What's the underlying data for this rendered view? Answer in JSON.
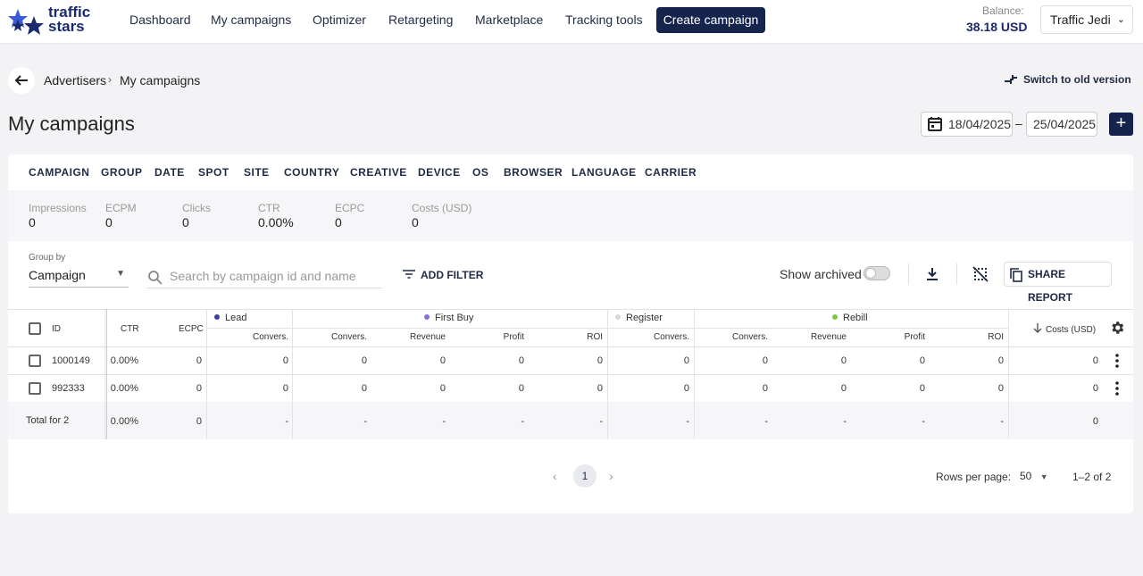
{
  "brand": {
    "name_line1": "traffic",
    "name_line2": "stars"
  },
  "nav": {
    "items": [
      "Dashboard",
      "My campaigns",
      "Optimizer",
      "Retargeting",
      "Marketplace",
      "Tracking tools"
    ],
    "create_campaign": "Create campaign",
    "balance_label": "Balance:",
    "balance_value": "38.18 USD",
    "account_name": "Traffic Jedi"
  },
  "breadcrumb": {
    "items": [
      "Advertisers",
      "My campaigns"
    ],
    "switch_old": "Switch to old version"
  },
  "page": {
    "title": "My campaigns"
  },
  "date_range": {
    "from": "18/04/2025",
    "separator": "–",
    "to": "25/04/2025"
  },
  "tabs": [
    "CAMPAIGN",
    "GROUP",
    "DATE",
    "SPOT",
    "SITE",
    "COUNTRY",
    "CREATIVE",
    "DEVICE",
    "OS",
    "BROWSER",
    "LANGUAGE",
    "CARRIER"
  ],
  "stats": [
    {
      "label": "Impressions",
      "value": "0"
    },
    {
      "label": "ECPM",
      "value": "0"
    },
    {
      "label": "Clicks",
      "value": "0"
    },
    {
      "label": "CTR",
      "value": "0.00%"
    },
    {
      "label": "ECPC",
      "value": "0"
    },
    {
      "label": "Costs (USD)",
      "value": "0"
    }
  ],
  "toolbar": {
    "group_by_label": "Group by",
    "group_by_value": "Campaign",
    "search_placeholder": "Search by campaign id and name",
    "add_filter": "ADD FILTER",
    "show_archived": "Show archived",
    "share_report": "SHARE REPORT"
  },
  "table": {
    "id_header": "ID",
    "ctr_header": "CTR",
    "ecpc_header": "ECPC",
    "costs_header": "Costs (USD)",
    "groups": [
      {
        "name": "Lead",
        "color": "#3b3f9e",
        "subs": [
          "Convers."
        ]
      },
      {
        "name": "First Buy",
        "color": "#8a6fd8",
        "subs": [
          "Convers.",
          "Revenue",
          "Profit",
          "ROI"
        ]
      },
      {
        "name": "Register",
        "color": "#d8d8d8",
        "subs": [
          "Convers."
        ]
      },
      {
        "name": "Rebill",
        "color": "#7cc64a",
        "subs": [
          "Convers.",
          "Revenue",
          "Profit",
          "ROI"
        ]
      }
    ],
    "rows": [
      {
        "id": "1000149",
        "ctr": "0.00%",
        "ecpc": "0",
        "lead": "0",
        "fb_conv": "0",
        "fb_rev": "0",
        "fb_profit": "0",
        "fb_roi": "0",
        "reg": "0",
        "rb_conv": "0",
        "rb_rev": "0",
        "rb_profit": "0",
        "rb_roi": "0",
        "costs": "0"
      },
      {
        "id": "992333",
        "ctr": "0.00%",
        "ecpc": "0",
        "lead": "0",
        "fb_conv": "0",
        "fb_rev": "0",
        "fb_profit": "0",
        "fb_roi": "0",
        "reg": "0",
        "rb_conv": "0",
        "rb_rev": "0",
        "rb_profit": "0",
        "rb_roi": "0",
        "costs": "0"
      }
    ],
    "total": {
      "label": "Total for 2",
      "ctr": "0.00%",
      "ecpc": "0",
      "dash": "-",
      "costs": "0"
    }
  },
  "pagination": {
    "current_page": "1",
    "rows_per_page_label": "Rows per page:",
    "rows_per_page": "50",
    "range": "1–2 of 2"
  }
}
